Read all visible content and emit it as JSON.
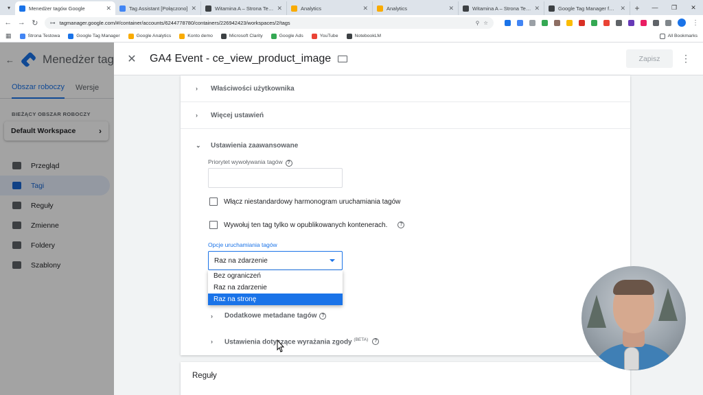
{
  "browser": {
    "tabs": [
      {
        "title": "Menedżer tagów Google",
        "color": "#1a73e8",
        "active": true
      },
      {
        "title": "Tag Assistant [Połączono]",
        "color": "#4285f4",
        "active": false
      },
      {
        "title": "Witamina A – Strona Testowa",
        "color": "#3c4043",
        "active": false
      },
      {
        "title": "Analytics",
        "color": "#f9ab00",
        "active": false
      },
      {
        "title": "Analytics",
        "color": "#f9ab00",
        "active": false
      },
      {
        "title": "Witamina A – Strona Testowa",
        "color": "#3c4043",
        "active": false
      },
      {
        "title": "Google Tag Manager for WordP",
        "color": "#3c4043",
        "active": false
      }
    ],
    "url": "tagmanager.google.com/#/container/accounts/6244778780/containers/226942423/workspaces/2/tags",
    "bookmarks": [
      {
        "label": "Strona Testowa",
        "color": "#4285f4"
      },
      {
        "label": "Google Tag Manager",
        "color": "#1a73e8"
      },
      {
        "label": "Google Analytics",
        "color": "#f9ab00"
      },
      {
        "label": "Konto demo",
        "color": "#f9ab00"
      },
      {
        "label": "Microsoft Clarity",
        "color": "#3c4043"
      },
      {
        "label": "Google Ads",
        "color": "#34a853"
      },
      {
        "label": "YouTube",
        "color": "#ea4335"
      },
      {
        "label": "NotebookLM",
        "color": "#3c4043"
      }
    ],
    "all_bookmarks": "All Bookmarks"
  },
  "app": {
    "title": "Menedżer tag",
    "tabs": {
      "workspace": "Obszar roboczy",
      "versions": "Wersje"
    },
    "workspace_label": "BIEŻĄCY OBSZAR ROBOCZY",
    "workspace_name": "Default Workspace",
    "nav": [
      {
        "label": "Przegląd",
        "icon": "overview-icon",
        "selected": false
      },
      {
        "label": "Tagi",
        "icon": "tag-icon",
        "selected": true
      },
      {
        "label": "Reguły",
        "icon": "trigger-icon",
        "selected": false
      },
      {
        "label": "Zmienne",
        "icon": "variables-icon",
        "selected": false
      },
      {
        "label": "Foldery",
        "icon": "folder-icon",
        "selected": false
      },
      {
        "label": "Szablony",
        "icon": "template-icon",
        "selected": false
      }
    ]
  },
  "editor": {
    "title": "GA4 Event - ce_view_product_image",
    "save_label": "Zapisz",
    "sections": {
      "user_props": "Właściwości użytkownika",
      "more_settings": "Więcej ustawień",
      "advanced": "Ustawienia zaawansowane"
    },
    "priority_label": "Priorytet wywoływania tagów",
    "priority_value": "",
    "custom_schedule_label": "Włącz niestandardowy harmonogram uruchamiania tagów",
    "published_only_label": "Wywołuj ten tag tylko w opublikowanych kontenerach.",
    "firing_options_label": "Opcje uruchamiania tagów",
    "firing_options_selected": "Raz na zdarzenie",
    "firing_options": [
      "Bez ograniczeń",
      "Raz na zdarzenie",
      "Raz na stronę"
    ],
    "highlighted_option": "Raz na stronę",
    "extra_metadata": "Dodatkowe metadane tagów",
    "consent_settings": "Ustawienia dotyczące wyrażania zgody",
    "consent_beta": "(BETA)",
    "triggers_title": "Reguły"
  }
}
